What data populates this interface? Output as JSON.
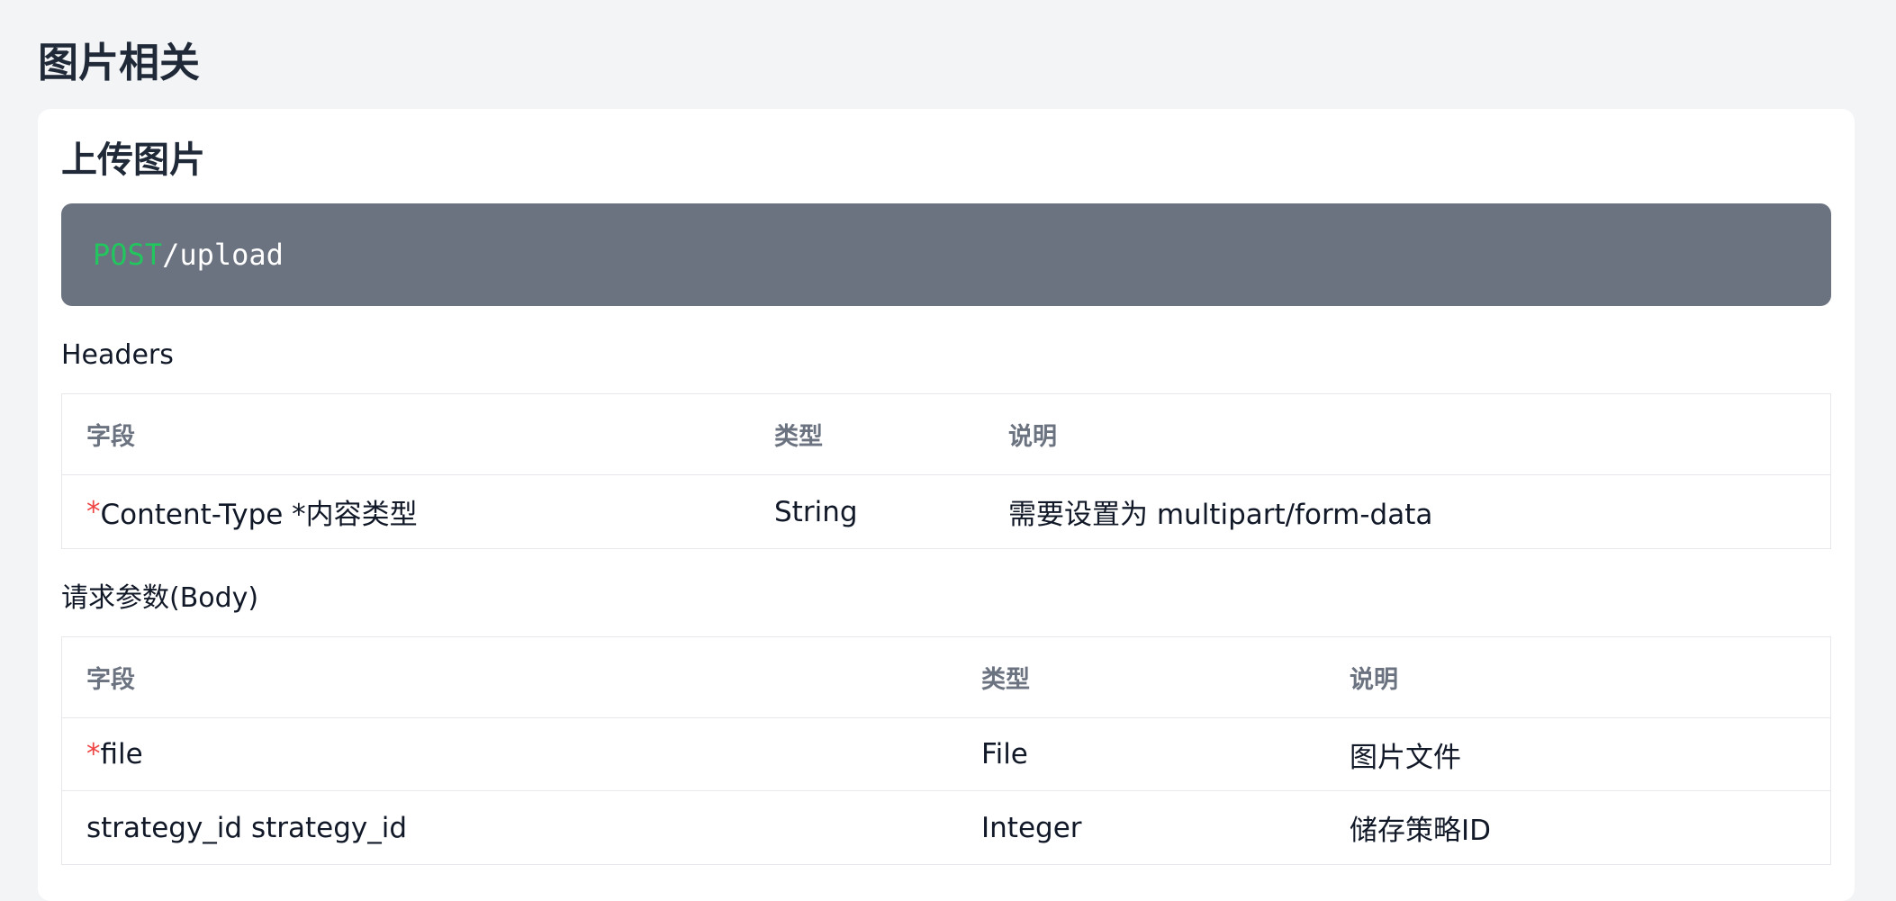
{
  "page": {
    "title": "图片相关"
  },
  "section": {
    "title": "上传图片",
    "endpoint": {
      "method": "POST",
      "path": "/upload",
      "method_color": "#22c55e",
      "background_color": "#6b7280"
    },
    "headers": {
      "label": "Headers",
      "columns": [
        "字段",
        "类型",
        "说明"
      ],
      "rows": [
        {
          "required_mark": "*",
          "field": "Content-Type *内容类型",
          "type": "String",
          "description": "需要设置为 multipart/form-data"
        }
      ]
    },
    "body": {
      "label": "请求参数(Body)",
      "columns": [
        "字段",
        "类型",
        "说明"
      ],
      "rows": [
        {
          "required_mark": "*",
          "field": "file",
          "type": "File",
          "description": "图片文件"
        },
        {
          "required_mark": "",
          "field": "strategy_id strategy_id",
          "type": "Integer",
          "description": "储存策略ID"
        }
      ]
    }
  }
}
